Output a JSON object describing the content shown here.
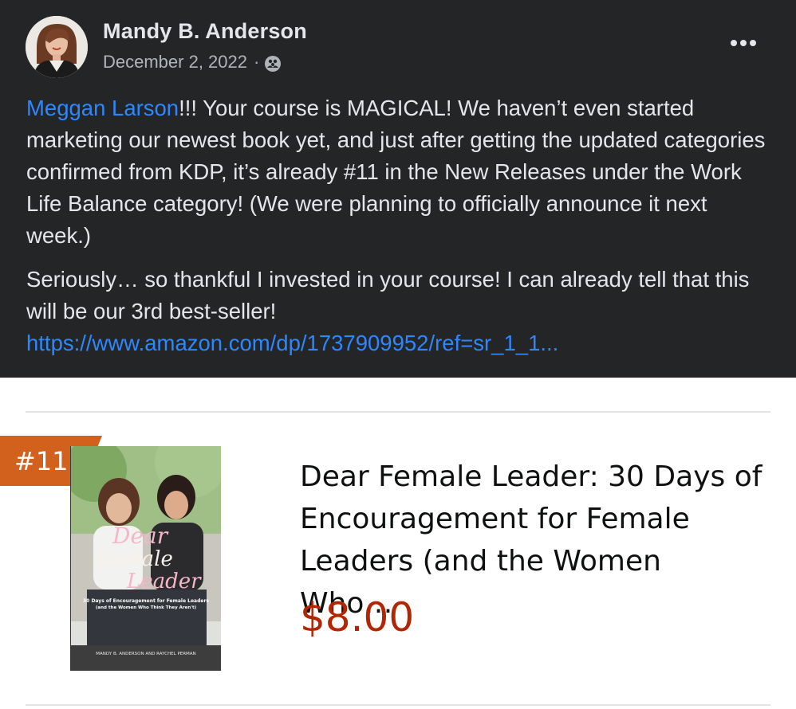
{
  "post": {
    "author": "Mandy B. Anderson",
    "date": "December 2, 2022",
    "separator": "·",
    "audience_icon": "friends-icon",
    "mention": "Meggan Larson",
    "paragraph1_rest": "!!! Your course is MAGICAL! We haven’t even started marketing our newest book yet, and just after getting the updated categories confirmed from KDP, it’s already #11 in the New Releases under the Work Life Balance category! (We were planning to officially announce it next week.)",
    "paragraph2": "Seriously… so thankful I invested in your course! I can already tell that this will be our 3rd best-seller!",
    "link": "https://www.amazon.com/dp/1737909952/ref=sr_1_1..."
  },
  "product": {
    "rank": "#11",
    "title": "Dear Female Leader: 30 Days of Encouragement for Female Leaders (and the Women Who…",
    "price": "$8.00",
    "cover": {
      "title_line1": "Dear",
      "title_line2": "Female",
      "title_line3": "Leader",
      "subtitle1": "30 Days of Encouragement for Female Leaders",
      "subtitle2": "(and the Women Who Think They Aren't)",
      "authors": "MANDY B. ANDERSON AND RAYCHEL PERMAN"
    }
  },
  "colors": {
    "post_bg": "#242526",
    "text": "#e4e6eb",
    "secondary": "#b0b3b8",
    "link": "#2d88ff",
    "price": "#b12704",
    "rank_badge": "#d2611d"
  }
}
